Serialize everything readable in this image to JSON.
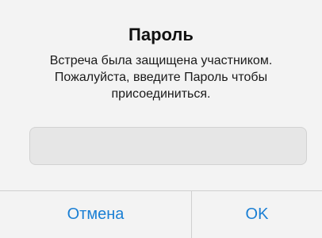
{
  "dialog": {
    "title": "Пароль",
    "message_lines": [
      "Встреча была защищена участником.",
      "Пожалуйста, введите Пароль чтобы",
      "присоединиться."
    ],
    "password_field": {
      "value": "",
      "placeholder": ""
    },
    "buttons": {
      "cancel_label": "Отмена",
      "ok_label": "OK"
    }
  },
  "colors": {
    "background": "#f3f3f3",
    "accent": "#1a7fd4",
    "field_background": "#e6e6e6",
    "divider": "#d0d0d0"
  }
}
